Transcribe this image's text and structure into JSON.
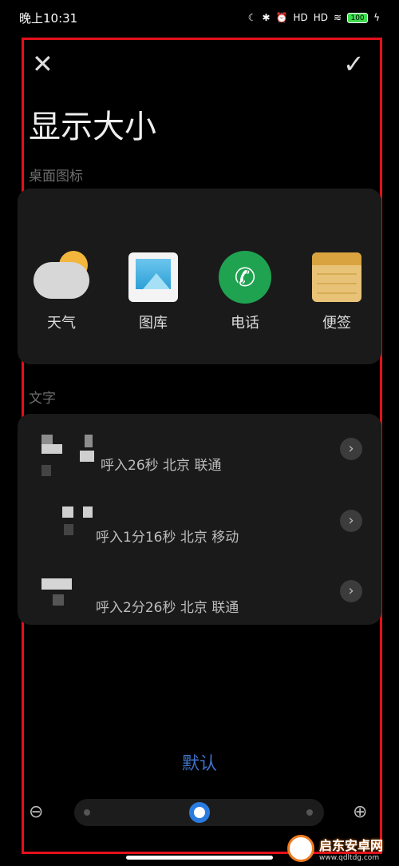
{
  "status_bar": {
    "time": "晚上10:31",
    "signal1": "HD",
    "signal2": "HD",
    "battery": "100"
  },
  "header": {
    "title": "显示大小"
  },
  "icons_section": {
    "label": "桌面图标",
    "apps": [
      {
        "label": "天气",
        "icon": "weather-icon"
      },
      {
        "label": "图库",
        "icon": "gallery-icon"
      },
      {
        "label": "电话",
        "icon": "phone-icon"
      },
      {
        "label": "便签",
        "icon": "notes-icon"
      }
    ]
  },
  "text_section": {
    "label": "文字",
    "calls": [
      {
        "detail": "呼入26秒 北京 联通"
      },
      {
        "detail": "呼入1分16秒 北京 移动"
      },
      {
        "detail": "呼入2分26秒 北京 联通"
      }
    ]
  },
  "footer": {
    "default_label": "默认",
    "slider_position": 0.5
  },
  "watermark": {
    "name": "启东安卓网",
    "url": "www.qdltdg.com"
  },
  "colors": {
    "accent": "#3f72c8",
    "highlight_frame": "#e3101a",
    "slider_thumb": "#2a7be0"
  }
}
